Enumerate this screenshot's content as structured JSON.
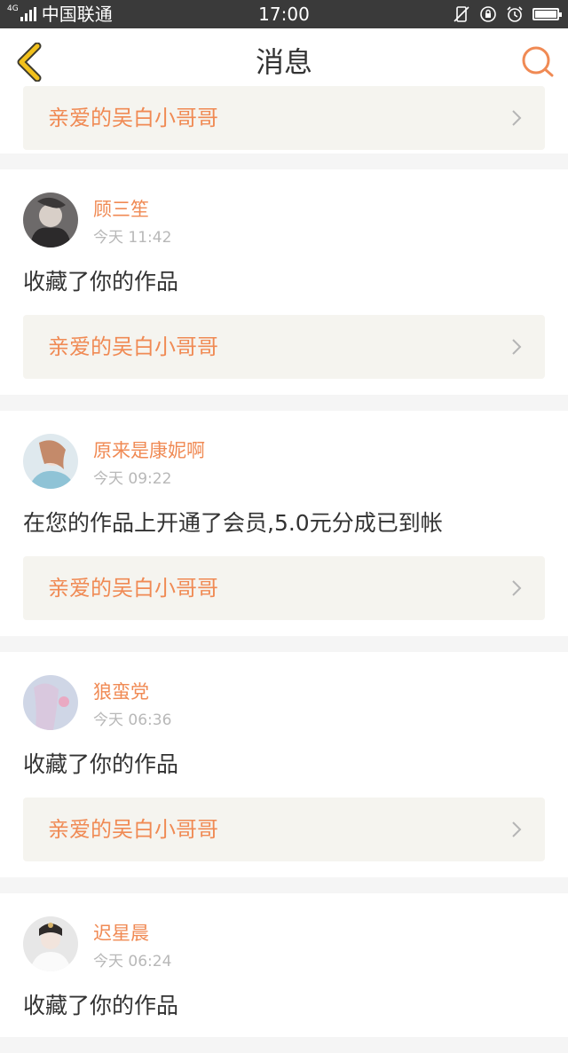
{
  "status_bar": {
    "network": "4G",
    "carrier": "中国联通",
    "time": "17:00",
    "icons": [
      "vibrate-off-icon",
      "rotation-lock-icon",
      "alarm-icon",
      "battery-icon"
    ]
  },
  "header": {
    "title": "消息",
    "back_icon": "chevron-left-icon",
    "search_icon": "search-icon"
  },
  "colors": {
    "accent": "#f08a54",
    "back_icon": "#f2c11c",
    "link_box_bg": "#f5f4ef",
    "status_bar_bg": "#3a3a3a"
  },
  "feed": {
    "partial_link": "亲爱的吴白小哥哥",
    "items": [
      {
        "user": "顾三笙",
        "time": "今天 11:42",
        "action": "收藏了你的作品",
        "link": "亲爱的吴白小哥哥"
      },
      {
        "user": "原来是康妮啊",
        "time": "今天 09:22",
        "action": "在您的作品上开通了会员,5.0元分成已到帐",
        "link": "亲爱的吴白小哥哥"
      },
      {
        "user": "狼蛮党",
        "time": "今天 06:36",
        "action": "收藏了你的作品",
        "link": "亲爱的吴白小哥哥"
      },
      {
        "user": "迟星晨",
        "time": "今天 06:24",
        "action": "收藏了你的作品",
        "link": ""
      }
    ]
  }
}
